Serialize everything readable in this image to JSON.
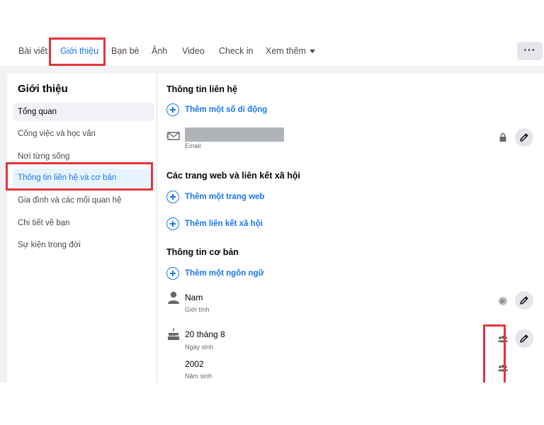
{
  "tabs": [
    {
      "label": "Bài viết",
      "active": false
    },
    {
      "label": "Giới thiệu",
      "active": true
    },
    {
      "label": "Bạn bè",
      "active": false
    },
    {
      "label": "Ảnh",
      "active": false
    },
    {
      "label": "Video",
      "active": false
    },
    {
      "label": "Check in",
      "active": false
    },
    {
      "label": "Xem thêm",
      "active": false,
      "has_dropdown": true
    }
  ],
  "more_button_label": "···",
  "sidebar": {
    "title": "Giới thiệu",
    "items": [
      {
        "label": "Tổng quan"
      },
      {
        "label": "Công việc và học vấn"
      },
      {
        "label": "Nơi từng sống"
      },
      {
        "label": "Thông tin liên hệ và cơ bản",
        "active": true
      },
      {
        "label": "Gia đình và các mối quan hệ"
      },
      {
        "label": "Chi tiết về bạn"
      },
      {
        "label": "Sự kiện trong đời"
      }
    ]
  },
  "contact": {
    "title": "Thông tin liên hệ",
    "add_phone": "Thêm một số di động",
    "email_sub": "Email",
    "email_icon": "envelope-icon",
    "privacy_icon": "lock-icon"
  },
  "web": {
    "title": "Các trang web và liên kết xã hội",
    "add_website": "Thêm một trang web",
    "add_social": "Thêm liên kết xã hội"
  },
  "basic": {
    "title": "Thông tin cơ bản",
    "add_language": "Thêm một ngôn ngữ",
    "gender_value": "Nam",
    "gender_sub": "Giới tính",
    "gender_icon": "person-icon",
    "gender_privacy_icon": "globe-icon",
    "birthday_value": "20 tháng 8",
    "birthday_sub": "Ngày sinh",
    "birthday_icon": "cake-icon",
    "birthday_privacy_icon": "friends-icon",
    "birthyear_value": "2002",
    "birthyear_sub": "Năm sinh",
    "birthyear_privacy_icon": "friends-icon"
  },
  "colors": {
    "accent": "#1877f2",
    "highlight": "#e5343a",
    "background": "#f0f2f5"
  }
}
